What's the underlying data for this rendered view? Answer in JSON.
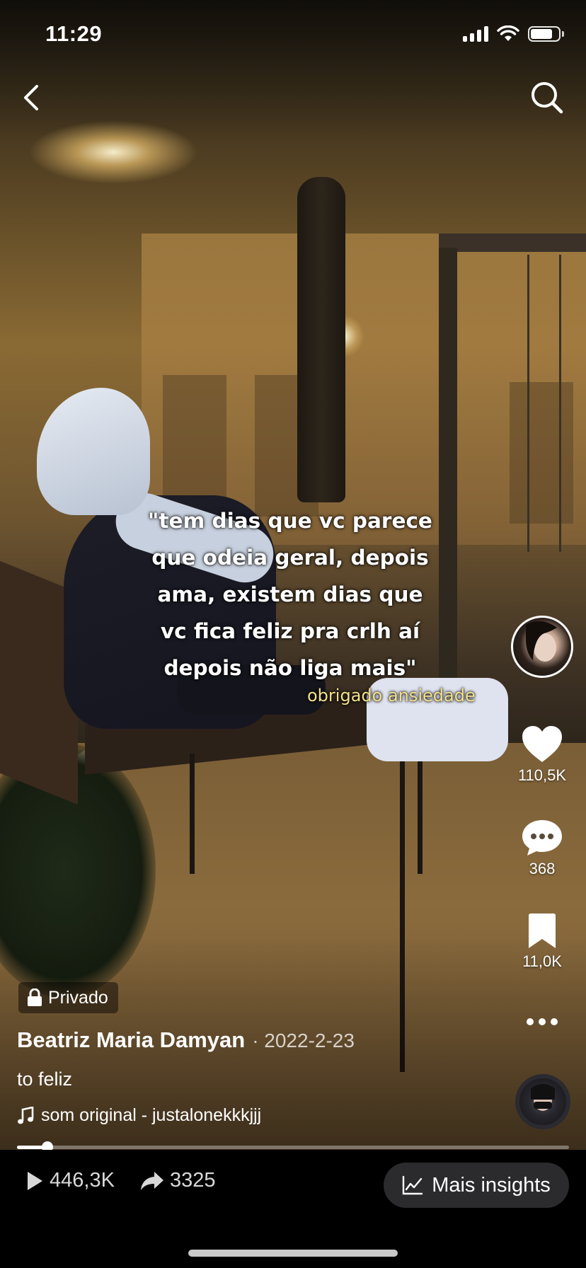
{
  "status_bar": {
    "time": "11:29"
  },
  "nav": {
    "back_icon": "chevron-left-icon",
    "search_icon": "search-icon"
  },
  "video": {
    "caption_lines": [
      "\"tem dias que vc parece",
      "que odeia geral, depois",
      "ama, existem dias que",
      "vc fica feliz pra crlh aí",
      "depois não liga mais\""
    ],
    "caption_sub": "obrigado ansiedade"
  },
  "actions": {
    "likes": "110,5K",
    "comments": "368",
    "saves": "11,0K"
  },
  "post": {
    "privacy_label": "Privado",
    "author": "Beatriz Maria Damyan",
    "date": "· 2022-2-23",
    "description": "to feliz",
    "sound": "som original - justalonekkkjjj",
    "progress": 0.055
  },
  "footer": {
    "plays": "446,3K",
    "shares": "3325",
    "insights_label": "Mais insights"
  },
  "colors": {
    "caption_sub": "#f3e08a",
    "insights_bg": "#2b2b2e",
    "bottom_bar": "#000000"
  }
}
